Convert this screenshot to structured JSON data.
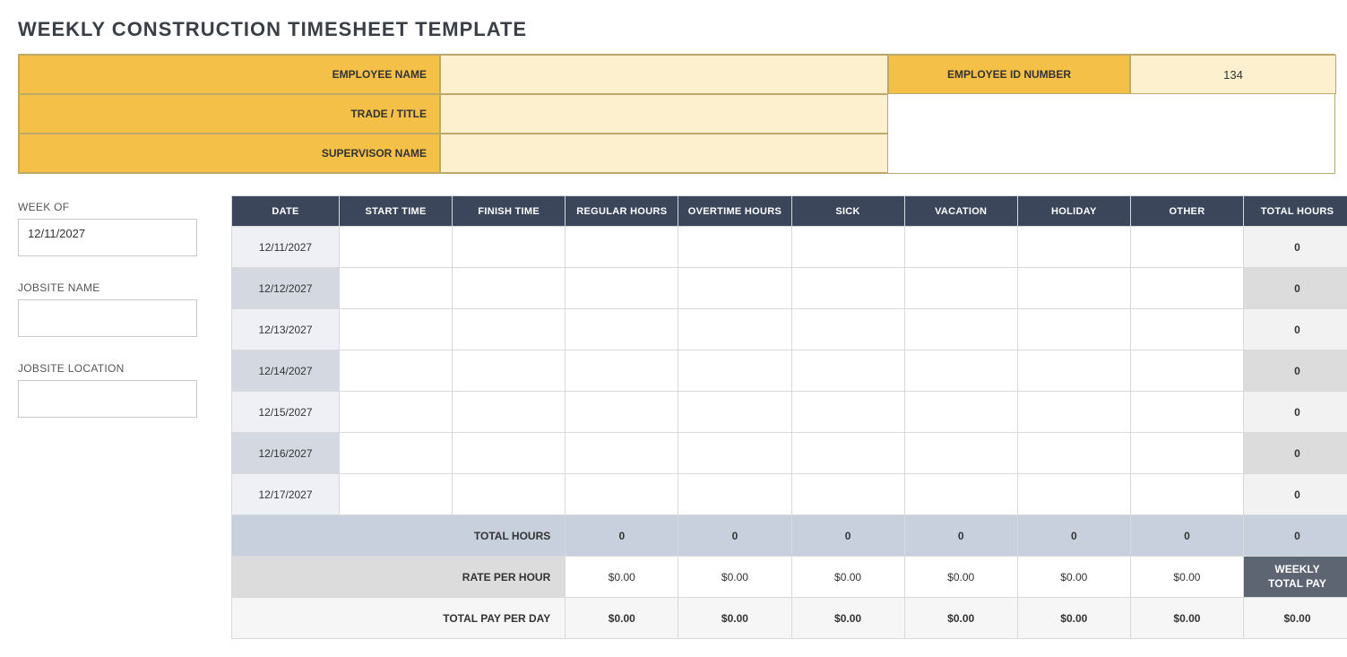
{
  "title": "WEEKLY CONSTRUCTION TIMESHEET TEMPLATE",
  "header": {
    "employee_name_label": "EMPLOYEE NAME",
    "employee_name_value": "",
    "trade_title_label": "TRADE / TITLE",
    "trade_title_value": "",
    "supervisor_name_label": "SUPERVISOR NAME",
    "supervisor_name_value": "",
    "employee_id_label": "EMPLOYEE ID NUMBER",
    "employee_id_value": "134"
  },
  "sidebar": {
    "week_of_label": "WEEK OF",
    "week_of_value": "12/11/2027",
    "jobsite_name_label": "JOBSITE NAME",
    "jobsite_name_value": "",
    "jobsite_location_label": "JOBSITE LOCATION",
    "jobsite_location_value": ""
  },
  "columns": {
    "date": "DATE",
    "start_time": "START TIME",
    "finish_time": "FINISH TIME",
    "regular_hours": "REGULAR HOURS",
    "overtime_hours": "OVERTIME HOURS",
    "sick": "SICK",
    "vacation": "VACATION",
    "holiday": "HOLIDAY",
    "other": "OTHER",
    "total_hours": "TOTAL HOURS"
  },
  "rows": [
    {
      "date": "12/11/2027",
      "start_time": "",
      "finish_time": "",
      "regular_hours": "",
      "overtime_hours": "",
      "sick": "",
      "vacation": "",
      "holiday": "",
      "other": "",
      "total_hours": "0"
    },
    {
      "date": "12/12/2027",
      "start_time": "",
      "finish_time": "",
      "regular_hours": "",
      "overtime_hours": "",
      "sick": "",
      "vacation": "",
      "holiday": "",
      "other": "",
      "total_hours": "0"
    },
    {
      "date": "12/13/2027",
      "start_time": "",
      "finish_time": "",
      "regular_hours": "",
      "overtime_hours": "",
      "sick": "",
      "vacation": "",
      "holiday": "",
      "other": "",
      "total_hours": "0"
    },
    {
      "date": "12/14/2027",
      "start_time": "",
      "finish_time": "",
      "regular_hours": "",
      "overtime_hours": "",
      "sick": "",
      "vacation": "",
      "holiday": "",
      "other": "",
      "total_hours": "0"
    },
    {
      "date": "12/15/2027",
      "start_time": "",
      "finish_time": "",
      "regular_hours": "",
      "overtime_hours": "",
      "sick": "",
      "vacation": "",
      "holiday": "",
      "other": "",
      "total_hours": "0"
    },
    {
      "date": "12/16/2027",
      "start_time": "",
      "finish_time": "",
      "regular_hours": "",
      "overtime_hours": "",
      "sick": "",
      "vacation": "",
      "holiday": "",
      "other": "",
      "total_hours": "0"
    },
    {
      "date": "12/17/2027",
      "start_time": "",
      "finish_time": "",
      "regular_hours": "",
      "overtime_hours": "",
      "sick": "",
      "vacation": "",
      "holiday": "",
      "other": "",
      "total_hours": "0"
    }
  ],
  "footer": {
    "total_hours_label": "TOTAL HOURS",
    "total_hours": {
      "regular_hours": "0",
      "overtime_hours": "0",
      "sick": "0",
      "vacation": "0",
      "holiday": "0",
      "other": "0",
      "total_hours": "0"
    },
    "rate_label": "RATE PER HOUR",
    "rate": {
      "regular_hours": "$0.00",
      "overtime_hours": "$0.00",
      "sick": "$0.00",
      "vacation": "$0.00",
      "holiday": "$0.00",
      "other": "$0.00"
    },
    "weekly_total_pay_label": "WEEKLY TOTAL PAY",
    "pay_label": "TOTAL PAY PER DAY",
    "pay": {
      "regular_hours": "$0.00",
      "overtime_hours": "$0.00",
      "sick": "$0.00",
      "vacation": "$0.00",
      "holiday": "$0.00",
      "other": "$0.00",
      "total_hours": "$0.00"
    }
  }
}
